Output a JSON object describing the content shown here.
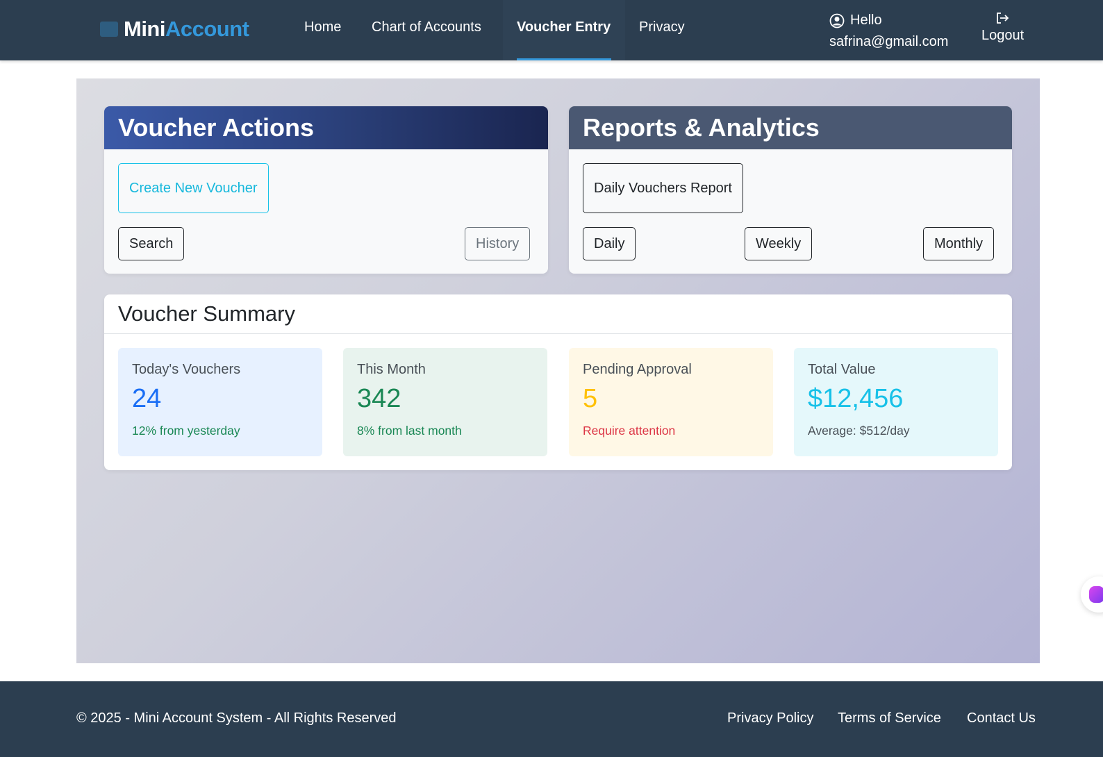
{
  "brand": {
    "part1": "Mini",
    "part2": "Account"
  },
  "nav": {
    "home": "Home",
    "chart_of_accounts": "Chart of Accounts",
    "voucher_entry": "Voucher Entry",
    "privacy": "Privacy"
  },
  "user": {
    "greeting": "Hello",
    "email": "safrina@gmail.com",
    "logout": "Logout"
  },
  "voucher_actions": {
    "title": "Voucher Actions",
    "create": "Create New Voucher",
    "search": "Search",
    "history": "History"
  },
  "reports": {
    "title": "Reports & Analytics",
    "daily_report": "Daily Vouchers Report",
    "daily": "Daily",
    "weekly": "Weekly",
    "monthly": "Monthly"
  },
  "summary": {
    "title": "Voucher Summary",
    "stats": [
      {
        "label": "Today's Vouchers",
        "value": "24",
        "note": "12% from yesterday"
      },
      {
        "label": "This Month",
        "value": "342",
        "note": "8% from last month"
      },
      {
        "label": "Pending Approval",
        "value": "5",
        "note": "Require attention"
      },
      {
        "label": "Total Value",
        "value": "$12,456",
        "note": "Average: $512/day"
      }
    ]
  },
  "footer": {
    "copyright": "© 2025 - Mini Account System - All Rights Reserved",
    "privacy_policy": "Privacy Policy",
    "terms": "Terms of Service",
    "contact": "Contact Us"
  },
  "colors": {
    "navbar": "#2c3e50",
    "accent": "#3498db",
    "info": "#17c1e8",
    "success": "#198754",
    "warning": "#ffc107",
    "danger": "#dc3545"
  },
  "icons": {
    "user": "user-circle-icon",
    "logout": "logout-icon"
  }
}
